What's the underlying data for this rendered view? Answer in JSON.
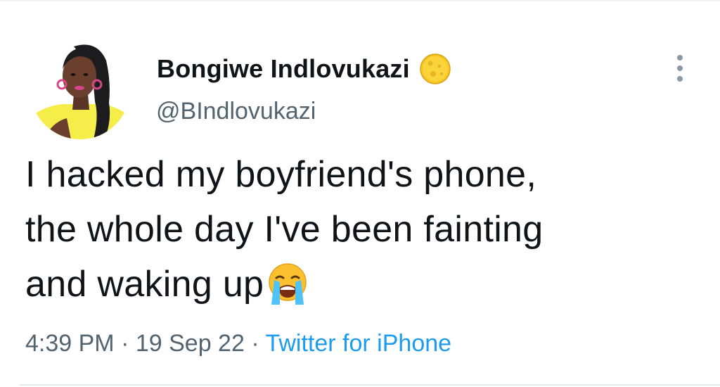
{
  "author": {
    "display_name": "Bongiwe Indlovukazi",
    "handle": "@BIndlovukazi",
    "avatar_icon": "profile-photo",
    "badge_icon": "moon-emoji-icon"
  },
  "tweet": {
    "text_lines": [
      "I hacked my boyfriend's phone,",
      "the whole day I've been fainting",
      "and waking up"
    ],
    "trailing_emoji": "loudly-crying-face-icon"
  },
  "meta": {
    "time": "4:39 PM",
    "separator": " · ",
    "date": "19 Sep 22",
    "source": "Twitter for iPhone"
  },
  "actions": {
    "more_icon": "more-vertical-icon"
  },
  "colors": {
    "text_primary": "#0f1419",
    "text_secondary": "#536471",
    "link": "#1d9bf0",
    "divider": "#eff3f4"
  }
}
